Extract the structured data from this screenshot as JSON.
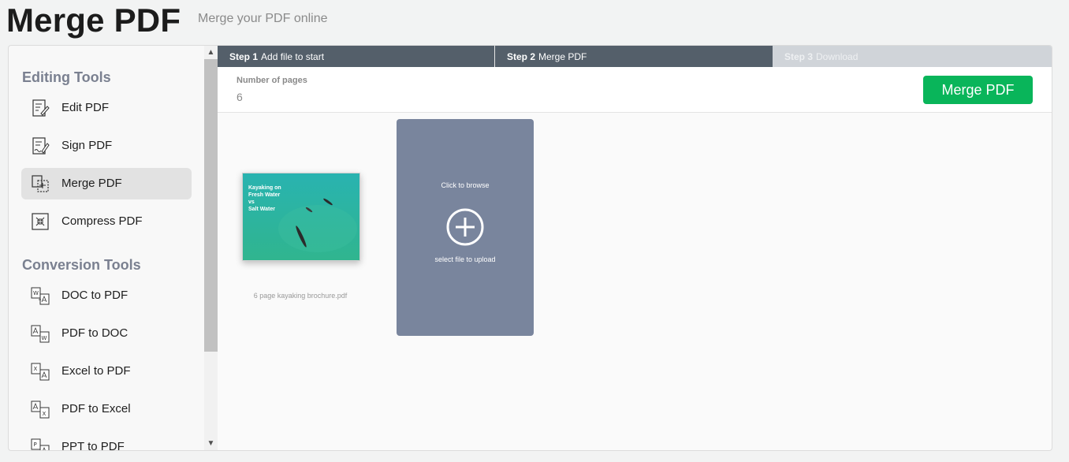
{
  "header": {
    "title": "Merge PDF",
    "subtitle": "Merge your PDF online"
  },
  "sidebar": {
    "editing_heading": "Editing Tools",
    "editing_items": [
      {
        "label": "Edit PDF",
        "icon": "edit-pdf-icon"
      },
      {
        "label": "Sign PDF",
        "icon": "sign-pdf-icon"
      },
      {
        "label": "Merge PDF",
        "icon": "merge-pdf-icon",
        "active": true
      },
      {
        "label": "Compress PDF",
        "icon": "compress-pdf-icon"
      }
    ],
    "conversion_heading": "Conversion Tools",
    "conversion_items": [
      {
        "label": "DOC to PDF",
        "icon": "doc-to-pdf-icon"
      },
      {
        "label": "PDF to DOC",
        "icon": "pdf-to-doc-icon"
      },
      {
        "label": "Excel to PDF",
        "icon": "excel-to-pdf-icon"
      },
      {
        "label": "PDF to Excel",
        "icon": "pdf-to-excel-icon"
      },
      {
        "label": "PPT to PDF",
        "icon": "ppt-to-pdf-icon"
      }
    ]
  },
  "steps": [
    {
      "num": "Step 1",
      "label": "Add file to start",
      "state": "done"
    },
    {
      "num": "Step 2",
      "label": "Merge PDF",
      "state": "current"
    },
    {
      "num": "Step 3",
      "label": "Download",
      "state": "pending"
    }
  ],
  "toolbar": {
    "pages_label": "Number of pages",
    "pages_value": "6",
    "merge_button": "Merge PDF"
  },
  "file": {
    "thumb_text": [
      "Kayaking on",
      "Fresh Water",
      "vs",
      "Salt Water"
    ],
    "name": "6 page kayaking brochure.pdf"
  },
  "upload": {
    "browse_text": "Click to browse",
    "hint_text": "select file to upload"
  },
  "colors": {
    "accent_green": "#09b55a",
    "step_active": "#545f6a",
    "step_inactive": "#d0d4d9",
    "upload_zone": "#79859d",
    "section_heading": "#7a8090"
  }
}
